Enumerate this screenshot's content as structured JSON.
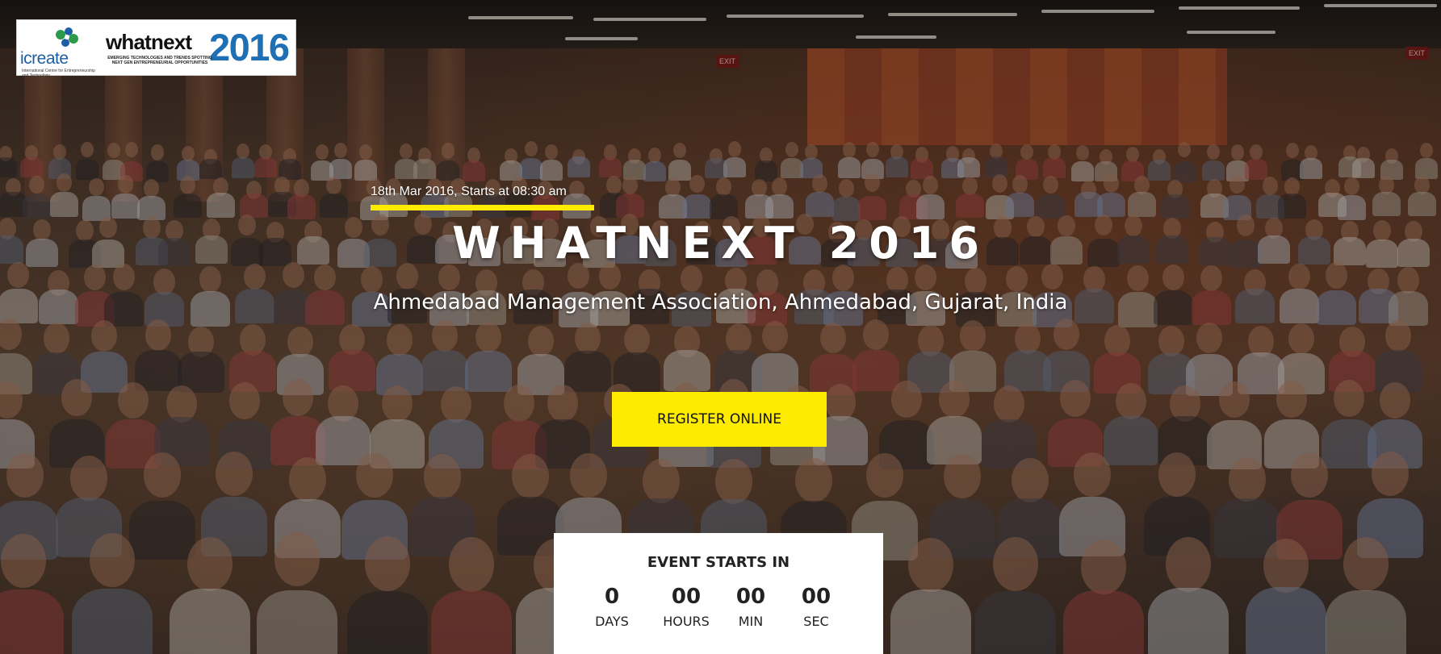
{
  "logo": {
    "icreate_text": "icreate",
    "icreate_sub": "International Centre for Entrepreneurship and Technology",
    "whatnext_text": "whatnext",
    "whatnext_year": "2016",
    "whatnext_sub": "EMERGING TECHNOLOGIES AND TRENDS SPOTTING NEXT GEN ENTREPRENEURIAL OPPORTUNITIES"
  },
  "hero": {
    "date_line": "18th Mar 2016, Starts at 08:30 am",
    "title": "WHATNEXT 2016",
    "venue": "Ahmedabad Management Association, Ahmedabad, Gujarat, India",
    "register_label": "REGISTER ONLINE",
    "exit_sign_left": "EXIT",
    "exit_sign_right": "EXIT"
  },
  "countdown": {
    "title": "EVENT STARTS IN",
    "units": [
      {
        "value": "0",
        "label": "DAYS"
      },
      {
        "value": "00",
        "label": "HOURS"
      },
      {
        "value": "00",
        "label": "MIN"
      },
      {
        "value": "00",
        "label": "SEC"
      }
    ]
  },
  "colors": {
    "accent_yellow": "#fdec00",
    "logo_blue": "#1e6fb3",
    "text_white": "#ffffff"
  }
}
